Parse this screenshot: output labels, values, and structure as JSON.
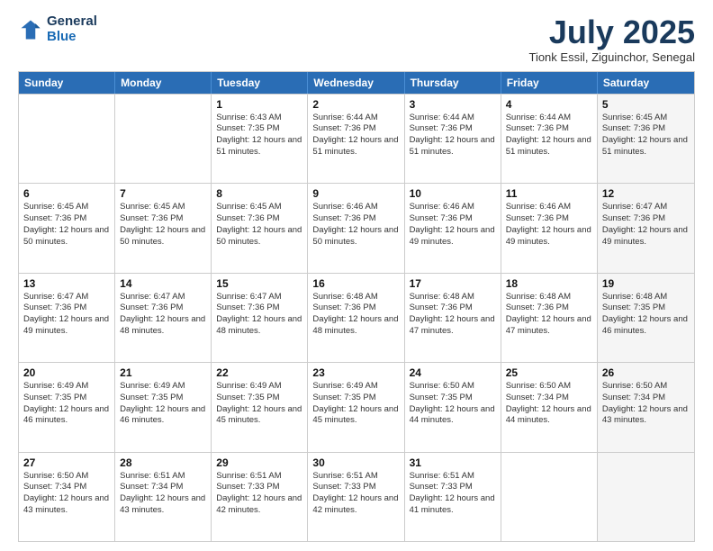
{
  "logo": {
    "line1": "General",
    "line2": "Blue"
  },
  "header": {
    "month": "July 2025",
    "location": "Tionk Essil, Ziguinchor, Senegal"
  },
  "weekdays": [
    "Sunday",
    "Monday",
    "Tuesday",
    "Wednesday",
    "Thursday",
    "Friday",
    "Saturday"
  ],
  "weeks": [
    [
      {
        "day": "",
        "sunrise": "",
        "sunset": "",
        "daylight": "",
        "shaded": false
      },
      {
        "day": "",
        "sunrise": "",
        "sunset": "",
        "daylight": "",
        "shaded": false
      },
      {
        "day": "1",
        "sunrise": "Sunrise: 6:43 AM",
        "sunset": "Sunset: 7:35 PM",
        "daylight": "Daylight: 12 hours and 51 minutes.",
        "shaded": false
      },
      {
        "day": "2",
        "sunrise": "Sunrise: 6:44 AM",
        "sunset": "Sunset: 7:36 PM",
        "daylight": "Daylight: 12 hours and 51 minutes.",
        "shaded": false
      },
      {
        "day": "3",
        "sunrise": "Sunrise: 6:44 AM",
        "sunset": "Sunset: 7:36 PM",
        "daylight": "Daylight: 12 hours and 51 minutes.",
        "shaded": false
      },
      {
        "day": "4",
        "sunrise": "Sunrise: 6:44 AM",
        "sunset": "Sunset: 7:36 PM",
        "daylight": "Daylight: 12 hours and 51 minutes.",
        "shaded": false
      },
      {
        "day": "5",
        "sunrise": "Sunrise: 6:45 AM",
        "sunset": "Sunset: 7:36 PM",
        "daylight": "Daylight: 12 hours and 51 minutes.",
        "shaded": true
      }
    ],
    [
      {
        "day": "6",
        "sunrise": "Sunrise: 6:45 AM",
        "sunset": "Sunset: 7:36 PM",
        "daylight": "Daylight: 12 hours and 50 minutes.",
        "shaded": false
      },
      {
        "day": "7",
        "sunrise": "Sunrise: 6:45 AM",
        "sunset": "Sunset: 7:36 PM",
        "daylight": "Daylight: 12 hours and 50 minutes.",
        "shaded": false
      },
      {
        "day": "8",
        "sunrise": "Sunrise: 6:45 AM",
        "sunset": "Sunset: 7:36 PM",
        "daylight": "Daylight: 12 hours and 50 minutes.",
        "shaded": false
      },
      {
        "day": "9",
        "sunrise": "Sunrise: 6:46 AM",
        "sunset": "Sunset: 7:36 PM",
        "daylight": "Daylight: 12 hours and 50 minutes.",
        "shaded": false
      },
      {
        "day": "10",
        "sunrise": "Sunrise: 6:46 AM",
        "sunset": "Sunset: 7:36 PM",
        "daylight": "Daylight: 12 hours and 49 minutes.",
        "shaded": false
      },
      {
        "day": "11",
        "sunrise": "Sunrise: 6:46 AM",
        "sunset": "Sunset: 7:36 PM",
        "daylight": "Daylight: 12 hours and 49 minutes.",
        "shaded": false
      },
      {
        "day": "12",
        "sunrise": "Sunrise: 6:47 AM",
        "sunset": "Sunset: 7:36 PM",
        "daylight": "Daylight: 12 hours and 49 minutes.",
        "shaded": true
      }
    ],
    [
      {
        "day": "13",
        "sunrise": "Sunrise: 6:47 AM",
        "sunset": "Sunset: 7:36 PM",
        "daylight": "Daylight: 12 hours and 49 minutes.",
        "shaded": false
      },
      {
        "day": "14",
        "sunrise": "Sunrise: 6:47 AM",
        "sunset": "Sunset: 7:36 PM",
        "daylight": "Daylight: 12 hours and 48 minutes.",
        "shaded": false
      },
      {
        "day": "15",
        "sunrise": "Sunrise: 6:47 AM",
        "sunset": "Sunset: 7:36 PM",
        "daylight": "Daylight: 12 hours and 48 minutes.",
        "shaded": false
      },
      {
        "day": "16",
        "sunrise": "Sunrise: 6:48 AM",
        "sunset": "Sunset: 7:36 PM",
        "daylight": "Daylight: 12 hours and 48 minutes.",
        "shaded": false
      },
      {
        "day": "17",
        "sunrise": "Sunrise: 6:48 AM",
        "sunset": "Sunset: 7:36 PM",
        "daylight": "Daylight: 12 hours and 47 minutes.",
        "shaded": false
      },
      {
        "day": "18",
        "sunrise": "Sunrise: 6:48 AM",
        "sunset": "Sunset: 7:36 PM",
        "daylight": "Daylight: 12 hours and 47 minutes.",
        "shaded": false
      },
      {
        "day": "19",
        "sunrise": "Sunrise: 6:48 AM",
        "sunset": "Sunset: 7:35 PM",
        "daylight": "Daylight: 12 hours and 46 minutes.",
        "shaded": true
      }
    ],
    [
      {
        "day": "20",
        "sunrise": "Sunrise: 6:49 AM",
        "sunset": "Sunset: 7:35 PM",
        "daylight": "Daylight: 12 hours and 46 minutes.",
        "shaded": false
      },
      {
        "day": "21",
        "sunrise": "Sunrise: 6:49 AM",
        "sunset": "Sunset: 7:35 PM",
        "daylight": "Daylight: 12 hours and 46 minutes.",
        "shaded": false
      },
      {
        "day": "22",
        "sunrise": "Sunrise: 6:49 AM",
        "sunset": "Sunset: 7:35 PM",
        "daylight": "Daylight: 12 hours and 45 minutes.",
        "shaded": false
      },
      {
        "day": "23",
        "sunrise": "Sunrise: 6:49 AM",
        "sunset": "Sunset: 7:35 PM",
        "daylight": "Daylight: 12 hours and 45 minutes.",
        "shaded": false
      },
      {
        "day": "24",
        "sunrise": "Sunrise: 6:50 AM",
        "sunset": "Sunset: 7:35 PM",
        "daylight": "Daylight: 12 hours and 44 minutes.",
        "shaded": false
      },
      {
        "day": "25",
        "sunrise": "Sunrise: 6:50 AM",
        "sunset": "Sunset: 7:34 PM",
        "daylight": "Daylight: 12 hours and 44 minutes.",
        "shaded": false
      },
      {
        "day": "26",
        "sunrise": "Sunrise: 6:50 AM",
        "sunset": "Sunset: 7:34 PM",
        "daylight": "Daylight: 12 hours and 43 minutes.",
        "shaded": true
      }
    ],
    [
      {
        "day": "27",
        "sunrise": "Sunrise: 6:50 AM",
        "sunset": "Sunset: 7:34 PM",
        "daylight": "Daylight: 12 hours and 43 minutes.",
        "shaded": false
      },
      {
        "day": "28",
        "sunrise": "Sunrise: 6:51 AM",
        "sunset": "Sunset: 7:34 PM",
        "daylight": "Daylight: 12 hours and 43 minutes.",
        "shaded": false
      },
      {
        "day": "29",
        "sunrise": "Sunrise: 6:51 AM",
        "sunset": "Sunset: 7:33 PM",
        "daylight": "Daylight: 12 hours and 42 minutes.",
        "shaded": false
      },
      {
        "day": "30",
        "sunrise": "Sunrise: 6:51 AM",
        "sunset": "Sunset: 7:33 PM",
        "daylight": "Daylight: 12 hours and 42 minutes.",
        "shaded": false
      },
      {
        "day": "31",
        "sunrise": "Sunrise: 6:51 AM",
        "sunset": "Sunset: 7:33 PM",
        "daylight": "Daylight: 12 hours and 41 minutes.",
        "shaded": false
      },
      {
        "day": "",
        "sunrise": "",
        "sunset": "",
        "daylight": "",
        "shaded": false
      },
      {
        "day": "",
        "sunrise": "",
        "sunset": "",
        "daylight": "",
        "shaded": true
      }
    ]
  ]
}
